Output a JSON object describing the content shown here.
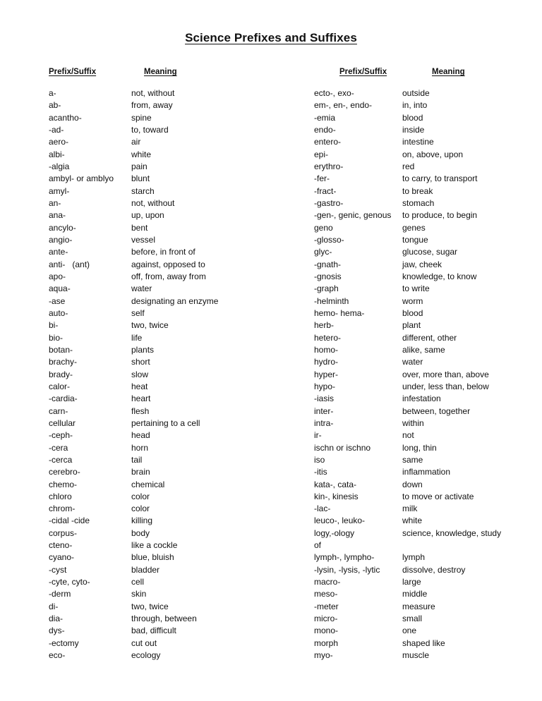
{
  "document": {
    "title": "Science Prefixes and Suffixes"
  },
  "headers": {
    "left_prefix": "Prefix/Suffix",
    "left_meaning": "Meaning",
    "right_prefix": "Prefix/Suffix",
    "right_meaning": "Meaning"
  },
  "columns": {
    "left": [
      {
        "term": "a-",
        "meaning": "not, without"
      },
      {
        "term": "ab-",
        "meaning": "from, away"
      },
      {
        "term": "acantho-",
        "meaning": "spine"
      },
      {
        "term": "-ad-",
        "meaning": "to, toward"
      },
      {
        "term": "aero-",
        "meaning": "air"
      },
      {
        "term": "albi-",
        "meaning": "white"
      },
      {
        "term": "-algia",
        "meaning": "pain"
      },
      {
        "term": "ambyl- or amblyo",
        "meaning": "blunt"
      },
      {
        "term": "amyl-",
        "meaning": "starch"
      },
      {
        "term": "an-",
        "meaning": "not, without"
      },
      {
        "term": "ana-",
        "meaning": "up, upon"
      },
      {
        "term": "ancylo-",
        "meaning": "bent"
      },
      {
        "term": "angio-",
        "meaning": "vessel"
      },
      {
        "term": "ante-",
        "meaning": "before, in front of"
      },
      {
        "term": "anti-   (ant)",
        "meaning": "against, opposed to"
      },
      {
        "term": "apo-",
        "meaning": "off, from, away from"
      },
      {
        "term": "aqua-",
        "meaning": "water"
      },
      {
        "term": "-ase",
        "meaning": "designating an enzyme"
      },
      {
        "term": "auto-",
        "meaning": "self"
      },
      {
        "term": "bi-",
        "meaning": "two, twice"
      },
      {
        "term": "bio-",
        "meaning": "life"
      },
      {
        "term": "botan-",
        "meaning": "plants"
      },
      {
        "term": "brachy-",
        "meaning": "short"
      },
      {
        "term": "brady-",
        "meaning": "slow"
      },
      {
        "term": "calor-",
        "meaning": "heat"
      },
      {
        "term": "-cardia-",
        "meaning": "heart"
      },
      {
        "term": "carn-",
        "meaning": "flesh"
      },
      {
        "term": "cellular",
        "meaning": "pertaining to a cell"
      },
      {
        "term": "-ceph-",
        "meaning": "head"
      },
      {
        "term": "-cera",
        "meaning": "horn"
      },
      {
        "term": "-cerca",
        "meaning": "tail"
      },
      {
        "term": "cerebro-",
        "meaning": "brain"
      },
      {
        "term": "chemo-",
        "meaning": "chemical"
      },
      {
        "term": "chloro",
        "meaning": "color"
      },
      {
        "term": "chrom-",
        "meaning": "color"
      },
      {
        "term": "-cidal -cide",
        "meaning": "killing"
      },
      {
        "term": "corpus-",
        "meaning": "body"
      },
      {
        "term": "cteno-",
        "meaning": "like a cockle"
      },
      {
        "term": "cyano-",
        "meaning": "blue, bluish"
      },
      {
        "term": "-cyst",
        "meaning": "bladder"
      },
      {
        "term": "-cyte, cyto-",
        "meaning": "cell"
      },
      {
        "term": "-derm",
        "meaning": "skin"
      },
      {
        "term": "di-",
        "meaning": "two, twice"
      },
      {
        "term": "dia-",
        "meaning": "through, between"
      },
      {
        "term": "dys-",
        "meaning": "bad, difficult"
      },
      {
        "term": "-ectomy",
        "meaning": "cut out"
      },
      {
        "term": "eco-",
        "meaning": "ecology"
      },
      {
        "term": "",
        "meaning": ""
      }
    ],
    "right": [
      {
        "term": "ecto-, exo-",
        "meaning": "outside"
      },
      {
        "term": "em-, en-, endo-",
        "meaning": "in, into"
      },
      {
        "term": "-emia",
        "meaning": "blood"
      },
      {
        "term": "endo-",
        "meaning": "inside"
      },
      {
        "term": "entero-",
        "meaning": "intestine"
      },
      {
        "term": "epi-",
        "meaning": "on, above, upon"
      },
      {
        "term": "erythro-",
        "meaning": "red"
      },
      {
        "term": "-fer-",
        "meaning": "to carry, to transport"
      },
      {
        "term": "-fract-",
        "meaning": "to break"
      },
      {
        "term": "-gastro-",
        "meaning": "stomach"
      },
      {
        "term": "-gen-, genic, genous",
        "meaning": "to produce, to begin"
      },
      {
        "term": "geno",
        "meaning": "genes"
      },
      {
        "term": "-glosso-",
        "meaning": "tongue"
      },
      {
        "term": "glyc-",
        "meaning": "glucose, sugar"
      },
      {
        "term": "-gnath-",
        "meaning": "jaw, cheek"
      },
      {
        "term": "-gnosis",
        "meaning": "knowledge, to know"
      },
      {
        "term": "-graph",
        "meaning": "to write"
      },
      {
        "term": "-helminth",
        "meaning": "worm"
      },
      {
        "term": "hemo- hema-",
        "meaning": "blood"
      },
      {
        "term": "herb-",
        "meaning": "plant"
      },
      {
        "term": "hetero-",
        "meaning": "different, other"
      },
      {
        "term": "homo-",
        "meaning": "alike, same"
      },
      {
        "term": "hydro-",
        "meaning": "water"
      },
      {
        "term": "hyper-",
        "meaning": "over, more than, above"
      },
      {
        "term": "hypo-",
        "meaning": "under, less than, below"
      },
      {
        "term": "-iasis",
        "meaning": "infestation"
      },
      {
        "term": "inter-",
        "meaning": "between, together"
      },
      {
        "term": "intra-",
        "meaning": "within"
      },
      {
        "term": "ir-",
        "meaning": "not"
      },
      {
        "term": "ischn or ischno",
        "meaning": "long, thin"
      },
      {
        "term": "iso",
        "meaning": "same"
      },
      {
        "term": "-itis",
        "meaning": "inflammation"
      },
      {
        "term": "kata-, cata-",
        "meaning": "down"
      },
      {
        "term": "kin-, kinesis",
        "meaning": "to move or activate"
      },
      {
        "term": "-lac-",
        "meaning": "milk"
      },
      {
        "term": "leuco-, leuko-",
        "meaning": "white"
      },
      {
        "term": "logy,-ology",
        "meaning": "science, knowledge, study"
      },
      {
        "term": "of",
        "meaning": ""
      },
      {
        "term": "lymph-, lympho-",
        "meaning": "lymph"
      },
      {
        "term": "-lysin, -lysis, -lytic",
        "meaning": "dissolve, destroy"
      },
      {
        "term": "macro-",
        "meaning": "large"
      },
      {
        "term": "meso-",
        "meaning": "middle"
      },
      {
        "term": "-meter",
        "meaning": "measure"
      },
      {
        "term": "micro-",
        "meaning": "small"
      },
      {
        "term": "mono-",
        "meaning": "one"
      },
      {
        "term": "morph",
        "meaning": "shaped like"
      },
      {
        "term": "myo-",
        "meaning": "muscle"
      },
      {
        "term": "",
        "meaning": ""
      }
    ]
  }
}
